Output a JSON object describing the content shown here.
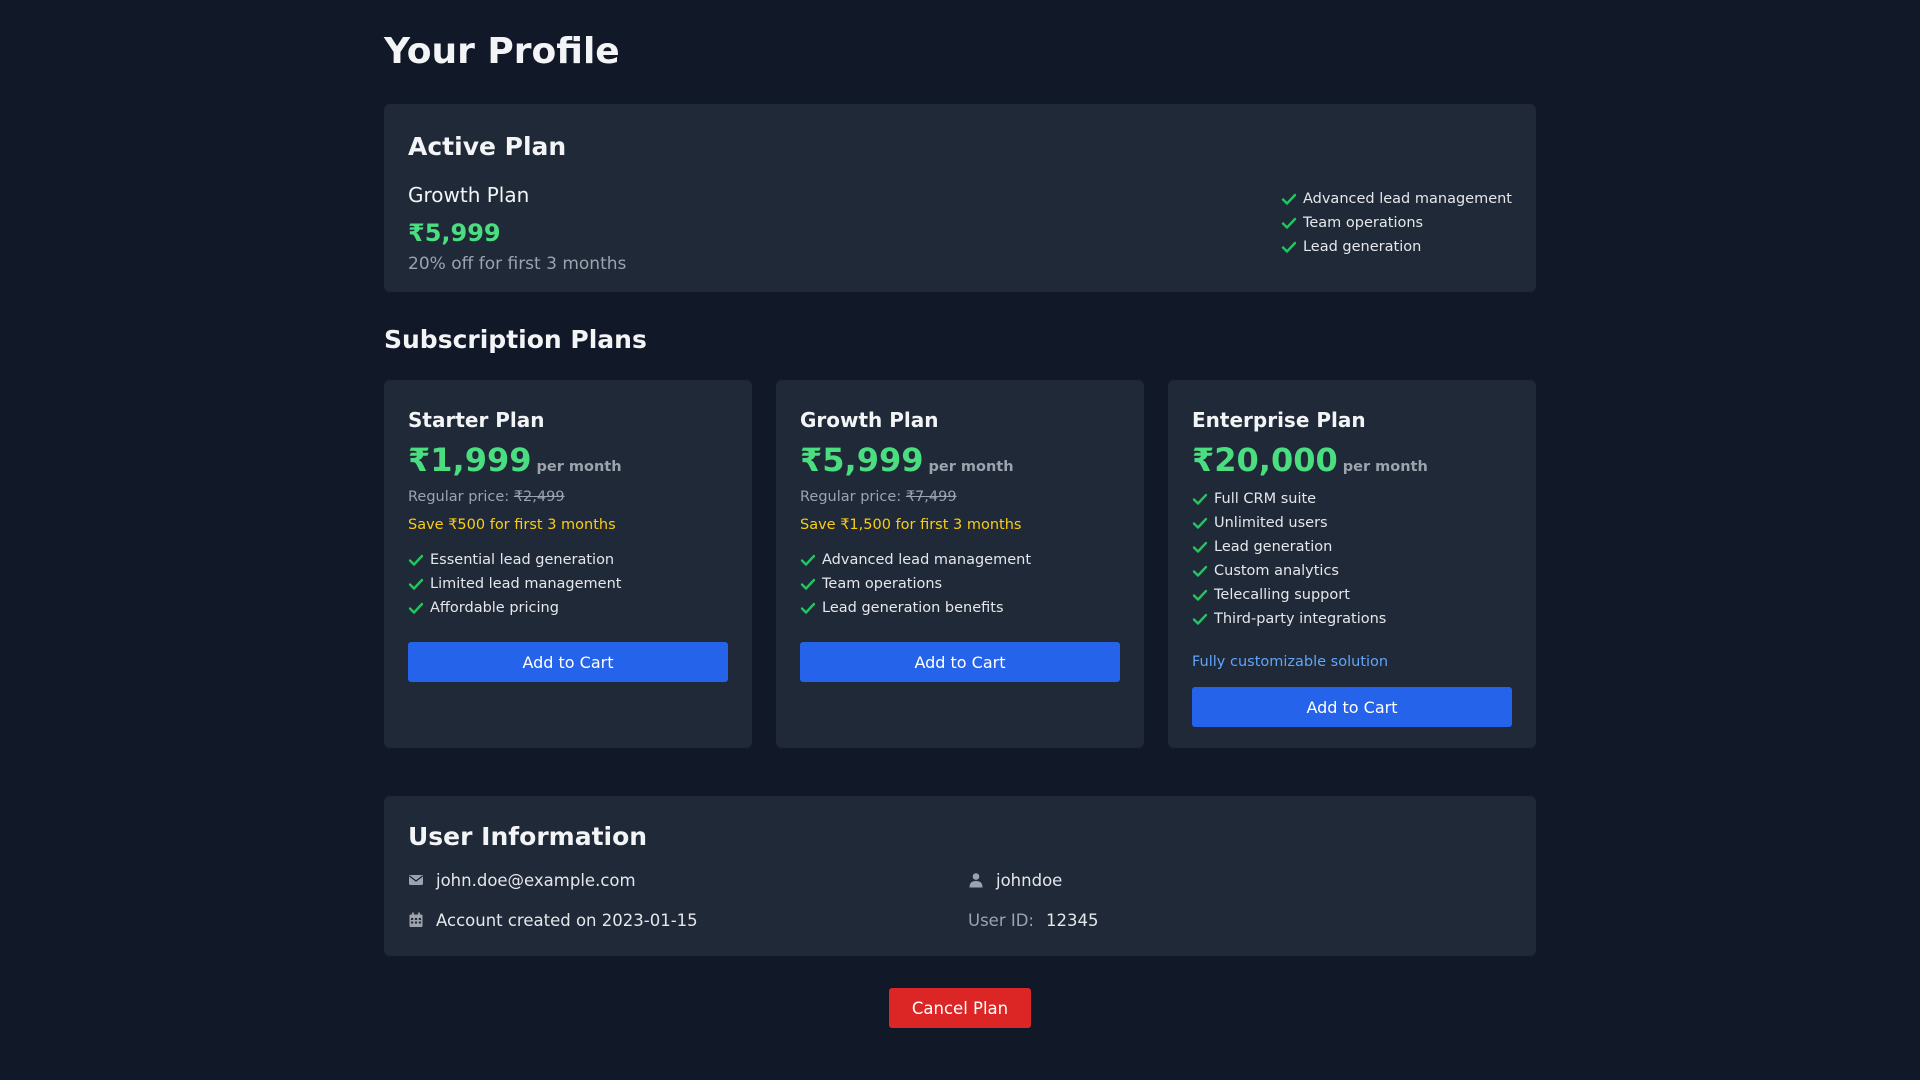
{
  "page": {
    "title": "Your Profile"
  },
  "active_plan": {
    "heading": "Active Plan",
    "name": "Growth Plan",
    "price": "₹5,999",
    "note": "20% off for first 3 months",
    "features": [
      "Advanced lead management",
      "Team operations",
      "Lead generation"
    ]
  },
  "subscriptions": {
    "heading": "Subscription Plans",
    "per_month": "per month",
    "regular_label": "Regular price:",
    "add_to_cart": "Add to Cart",
    "plans": [
      {
        "name": "Starter Plan",
        "price": "₹1,999",
        "regular_price": "₹2,499",
        "save": "Save ₹500 for first 3 months",
        "features": [
          "Essential lead generation",
          "Limited lead management",
          "Affordable pricing"
        ]
      },
      {
        "name": "Growth Plan",
        "price": "₹5,999",
        "regular_price": "₹7,499",
        "save": "Save ₹1,500 for first 3 months",
        "features": [
          "Advanced lead management",
          "Team operations",
          "Lead generation benefits"
        ]
      },
      {
        "name": "Enterprise Plan",
        "price": "₹20,000",
        "features": [
          "Full CRM suite",
          "Unlimited users",
          "Lead generation",
          "Custom analytics",
          "Telecalling support",
          "Third-party integrations"
        ],
        "custom_note": "Fully customizable solution"
      }
    ]
  },
  "user_info": {
    "heading": "User Information",
    "email": "john.doe@example.com",
    "username": "johndoe",
    "created": "Account created on 2023-01-15",
    "user_id_label": "User ID:",
    "user_id": "12345",
    "icons": {
      "email": "envelope-icon",
      "username": "user-icon",
      "created": "calendar-icon"
    }
  },
  "actions": {
    "cancel_plan": "Cancel Plan"
  },
  "colors": {
    "background": "#111827",
    "card": "#1f2937",
    "price_green": "#4ade80",
    "save_yellow": "#facc15",
    "primary_blue": "#2563eb",
    "link_blue": "#60a5fa",
    "danger_red": "#dc2626"
  }
}
